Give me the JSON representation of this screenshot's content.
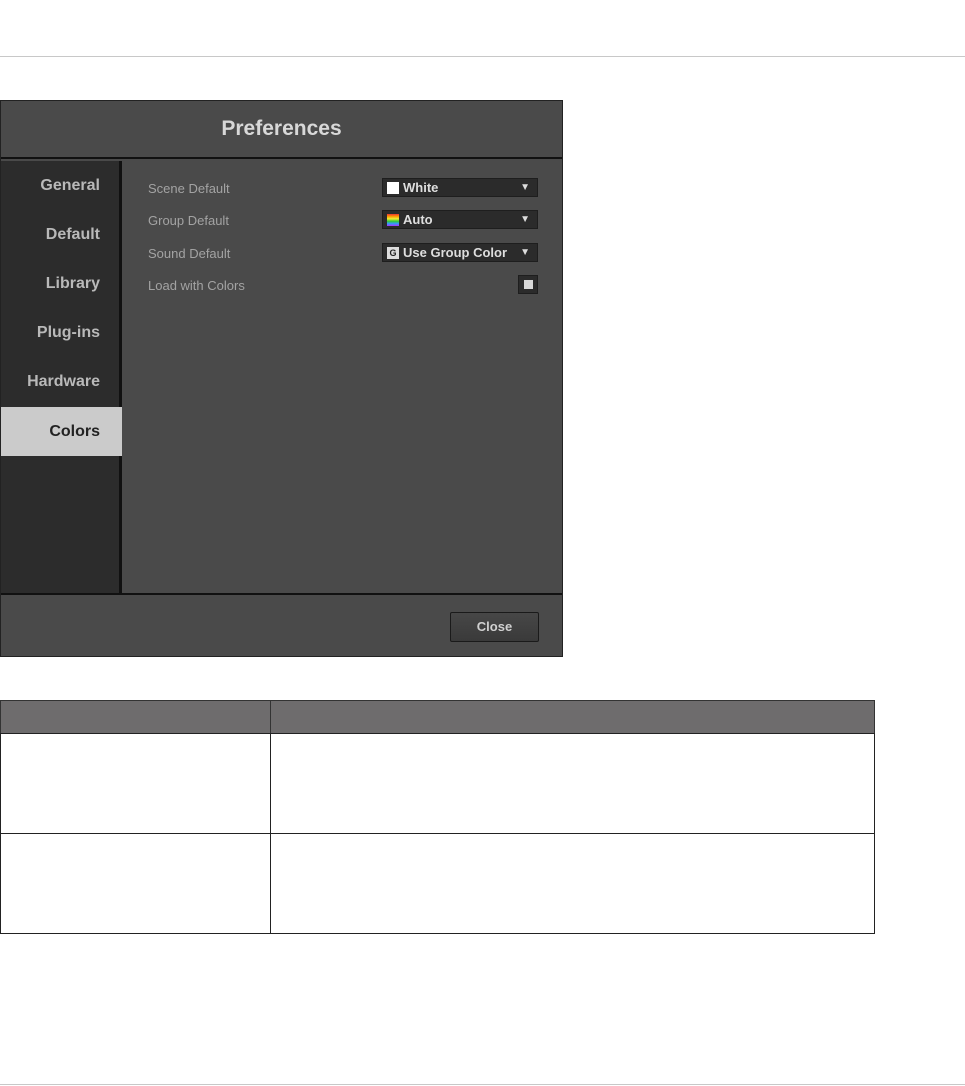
{
  "dialog": {
    "title": "Preferences",
    "close_label": "Close"
  },
  "sidebar": {
    "items": [
      {
        "label": "General"
      },
      {
        "label": "Default"
      },
      {
        "label": "Library"
      },
      {
        "label": "Plug-ins"
      },
      {
        "label": "Hardware"
      },
      {
        "label": "Colors",
        "selected": true
      }
    ]
  },
  "settings": {
    "scene_default": {
      "label": "Scene Default",
      "value": "White",
      "swatch": "#ffffff"
    },
    "group_default": {
      "label": "Group Default",
      "value": "Auto",
      "swatch": "rainbow"
    },
    "sound_default": {
      "label": "Sound Default",
      "value": "Use Group Color",
      "swatch_letter": "G"
    },
    "load_with_colors": {
      "label": "Load with Colors",
      "checked": true
    }
  },
  "colors": {
    "dialog_bg": "#4a4a4a",
    "sidebar_bg": "#2c2c2c",
    "selected_bg": "#cbcbcb",
    "table_header": "#6e6c6d"
  }
}
